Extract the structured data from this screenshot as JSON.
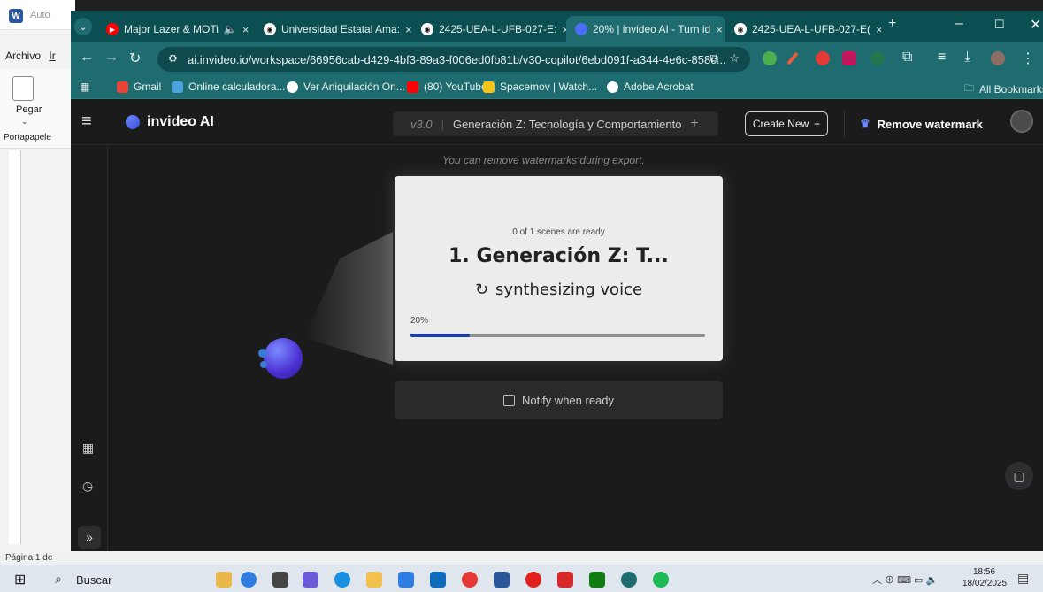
{
  "word": {
    "title_fragment": "Auto",
    "menu_archivo": "Archivo",
    "menu_in": "Ir",
    "pegar": "Pegar",
    "portapapeles": "Portapapele",
    "status_page": "Página 1 de"
  },
  "browser": {
    "tabs": [
      {
        "label": "Major Lazer & MOTi",
        "icon": "youtube-icon",
        "color": "#ff0000"
      },
      {
        "label": "Universidad Estatal Ama:",
        "icon": "chatgpt-icon",
        "color": "#ffffff"
      },
      {
        "label": "2425-UEA-L-UFB-027-E:",
        "icon": "chatgpt-icon",
        "color": "#ffffff"
      },
      {
        "label": "20% | invideo AI - Turn id",
        "icon": "invideo-icon",
        "color": "#4c6ef5"
      },
      {
        "label": "2425-UEA-L-UFB-027-E(",
        "icon": "chatgpt-icon",
        "color": "#ffffff"
      }
    ],
    "url": "ai.invideo.io/workspace/66956cab-d429-4bf3-89a3-f006ed0fb81b/v30-copilot/6ebd091f-a344-4e6c-858c...",
    "bookmarks": [
      {
        "label": "Gmail",
        "color": "#ea4335"
      },
      {
        "label": "Online calculadora...",
        "color": "#4aa3df"
      },
      {
        "label": "Ver Aniquilación On...",
        "color": "#ffffff"
      },
      {
        "label": "(80) YouTube",
        "color": "#ff0000"
      },
      {
        "label": "Spacemov | Watch...",
        "color": "#f5c518"
      },
      {
        "label": "Adobe Acrobat",
        "color": "#ffffff"
      }
    ],
    "all_bookmarks": "All Bookmarks"
  },
  "app": {
    "logo_text": "invideo AI",
    "version": "v3.0",
    "project_title": "Generación Z: Tecnología y Comportamiento",
    "create_new": "Create New",
    "remove_watermark": "Remove watermark",
    "watermark_note": "You can remove watermarks during export.",
    "scenes_ready": "0 of 1 scenes are ready",
    "scene_title": "1. Generación Z: T...",
    "status": "synthesizing voice",
    "progress_label": "20%",
    "progress": 0.2,
    "notify_label": "Notify when ready"
  },
  "taskbar": {
    "search_label": "Buscar",
    "time": "18:56",
    "date": "18/02/2025"
  },
  "colors": {
    "accent": "#1e3fa8",
    "tab_bg": "#0b4f53",
    "toolbar_bg": "#1f6c70"
  }
}
